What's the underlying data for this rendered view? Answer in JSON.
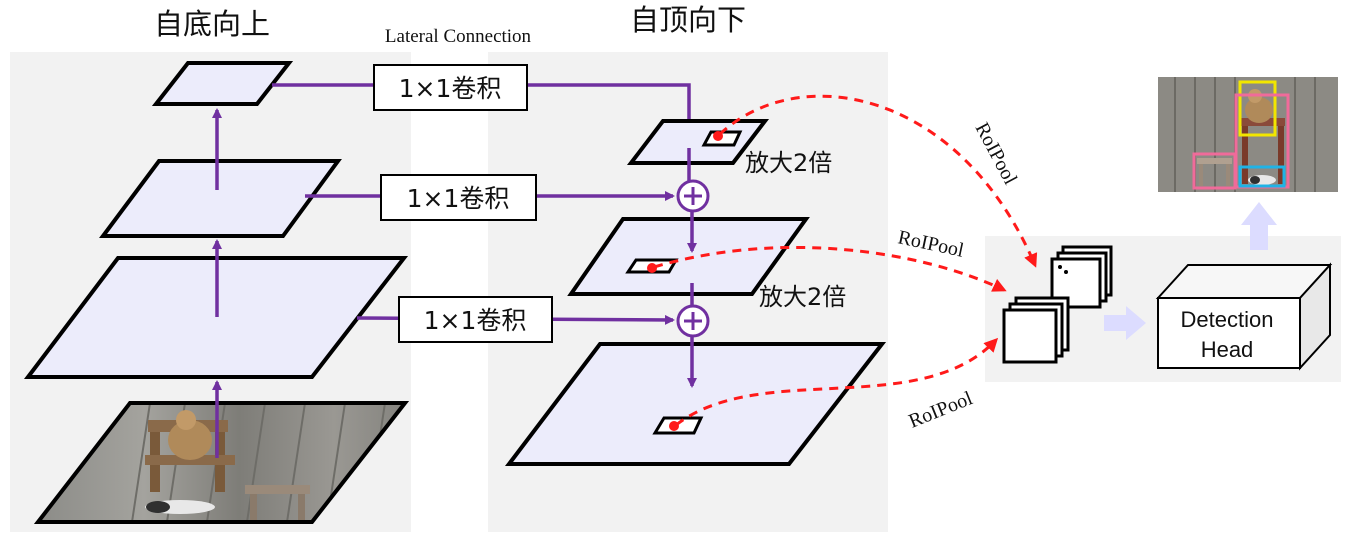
{
  "titles": {
    "bottom_up": "自底向上",
    "lateral": "Lateral Connection",
    "top_down": "自顶向下"
  },
  "conv_labels": [
    "1×1卷积",
    "1×1卷积",
    "1×1卷积"
  ],
  "upsample_labels": [
    "放大2倍",
    "放大2倍"
  ],
  "roipool_labels": [
    "RoIPool",
    "RoIPool",
    "RoIPool"
  ],
  "detection_head": {
    "line1": "Detection",
    "line2": "Head"
  },
  "colors": {
    "plane_fill": "#ececfb",
    "panel_bg": "#f2f2f2",
    "arrow": "#7030a0",
    "roi_dash": "#ff1a1a",
    "soft_arrow": "#dcdcff",
    "box_yellow": "#f2e600",
    "box_pink": "#f06b9a",
    "box_cyan": "#1fb3e6"
  }
}
